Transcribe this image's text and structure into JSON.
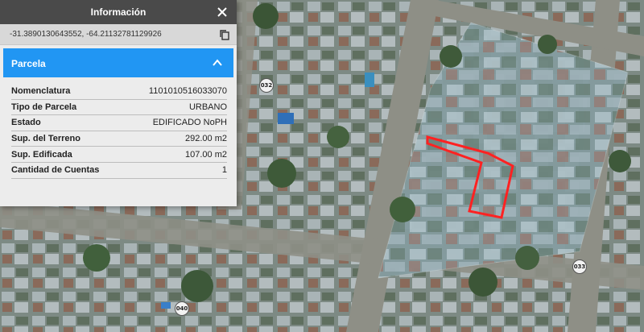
{
  "panel": {
    "title": "Información",
    "coordinates": "-31.3890130643552, -64.21132781129926",
    "section_title": "Parcela",
    "rows": [
      {
        "key": "Nomenclatura",
        "value": "1101010516033070"
      },
      {
        "key": "Tipo de Parcela",
        "value": "URBANO"
      },
      {
        "key": "Estado",
        "value": "EDIFICADO NoPH"
      },
      {
        "key": "Sup. del Terreno",
        "value": "292.00 m2"
      },
      {
        "key": "Sup. Edificada",
        "value": "107.00 m2"
      },
      {
        "key": "Cantidad de Cuentas",
        "value": "1"
      }
    ]
  },
  "map": {
    "block_labels": [
      "032",
      "033",
      "040"
    ],
    "highlight_color": "#ff2222"
  },
  "colors": {
    "header_bg": "#4a4a4a",
    "section_bg": "#2196f3",
    "panel_bg": "#ececec"
  }
}
